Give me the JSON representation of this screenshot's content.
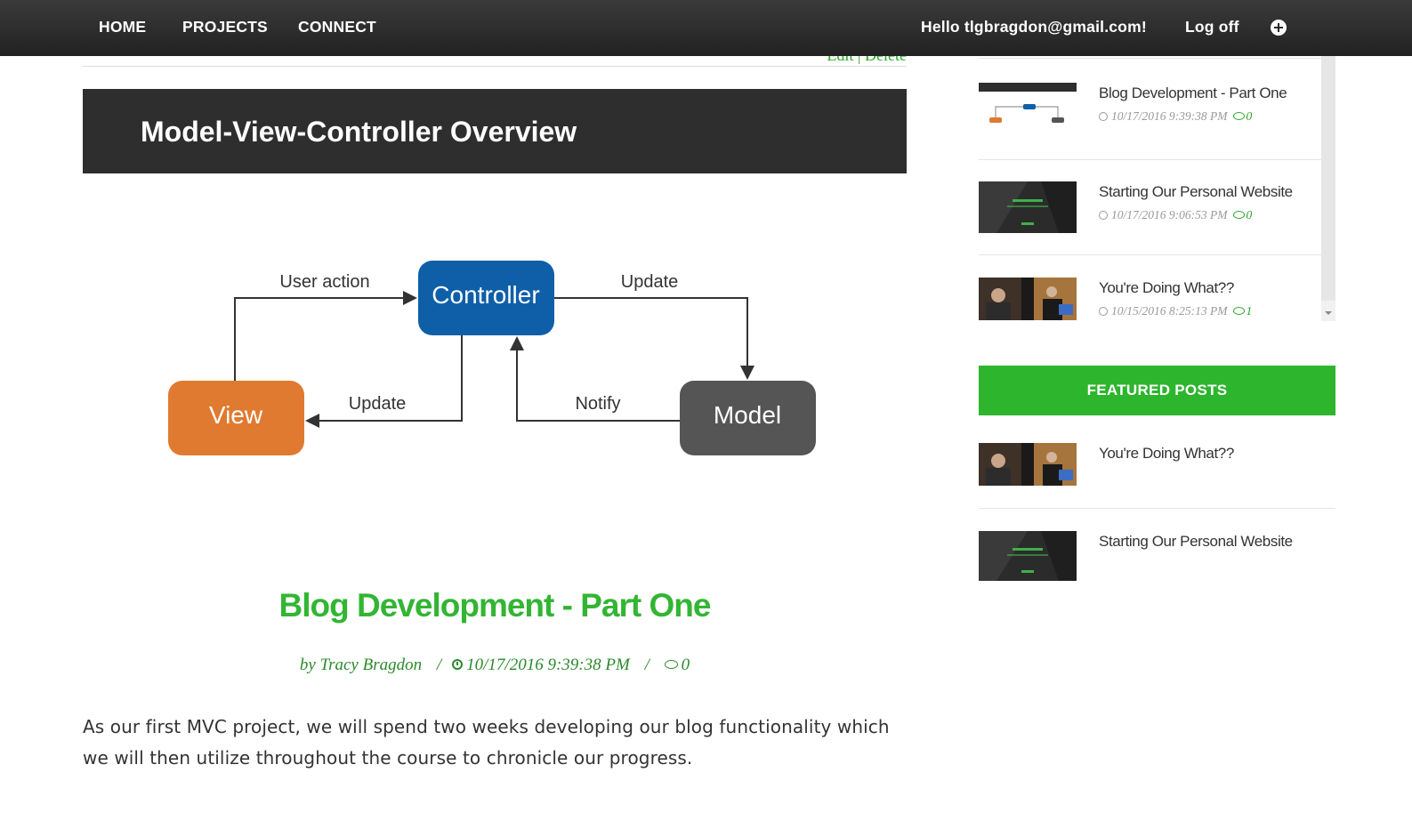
{
  "nav": {
    "home": "HOME",
    "projects": "PROJECTS",
    "connect": "CONNECT",
    "greeting": "Hello tlgbragdon@gmail.com!",
    "logoff": "Log off",
    "add_icon": "plus-circle-icon"
  },
  "post": {
    "edit_label": "Edit",
    "edit_sep": "|",
    "delete_label": "Delete",
    "image": {
      "header_title": "Model-View-Controller Overview",
      "nodes": {
        "controller": "Controller",
        "view": "View",
        "model": "Model"
      },
      "edges": {
        "user_action": "User action",
        "update_model": "Update",
        "update_view": "Update",
        "notify": "Notify"
      },
      "colors": {
        "controller": "#0e5fa8",
        "view": "#e07a30",
        "model": "#555555",
        "header": "#2e2e2e"
      }
    },
    "title": "Blog Development - Part One",
    "author": "by Tracy Bragdon",
    "date": "10/17/2016 9:39:38 PM",
    "meta_sep": "/",
    "comments": "0",
    "body": "As our first MVC project, we will spend two weeks developing our blog functionality which we will then utilize throughout the course to chronicle our progress."
  },
  "sidebar": {
    "recent": [
      {
        "title": "Blog Development - Part One",
        "date": "10/17/2016 9:39:38 PM",
        "comments": "0",
        "thumb": "mvc-diagram"
      },
      {
        "title": "Starting Our Personal Website",
        "date": "10/17/2016 9:06:53 PM",
        "comments": "0",
        "thumb": "website-screenshot"
      },
      {
        "title": "You're Doing What??",
        "date": "10/15/2016 8:25:13 PM",
        "comments": "1",
        "thumb": "presentation-photo"
      }
    ],
    "featured_heading": "FEATURED POSTS",
    "featured": [
      {
        "title": "You're Doing What??",
        "thumb": "presentation-photo"
      },
      {
        "title": "Starting Our Personal Website",
        "thumb": "website-screenshot"
      }
    ]
  },
  "theme": {
    "accent_green": "#2db52d",
    "nav_bg": "#2a2a2a"
  }
}
